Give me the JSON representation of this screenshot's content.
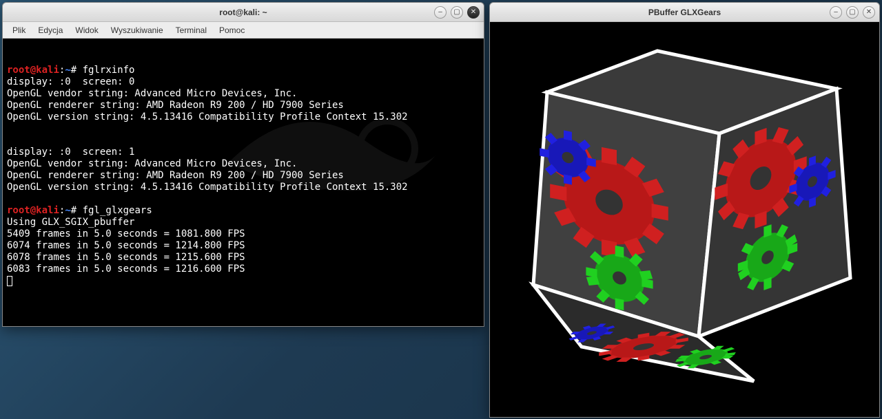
{
  "terminal_window": {
    "title": "root@kali: ~",
    "menu": {
      "file": "Plik",
      "edit": "Edycja",
      "view": "Widok",
      "search": "Wyszukiwanie",
      "terminal": "Terminal",
      "help": "Pomoc"
    },
    "prompt": {
      "user": "root",
      "at": "@",
      "host": "kali",
      "colon": ":",
      "path": "~",
      "symbol": "#"
    },
    "session": {
      "cmd1": "fglrxinfo",
      "out1a": "display: :0  screen: 0",
      "out1b": "OpenGL vendor string: Advanced Micro Devices, Inc.",
      "out1c": "OpenGL renderer string: AMD Radeon R9 200 / HD 7900 Series",
      "out1d": "OpenGL version string: 4.5.13416 Compatibility Profile Context 15.302",
      "blank": "",
      "out2a": "display: :0  screen: 1",
      "out2b": "OpenGL vendor string: Advanced Micro Devices, Inc.",
      "out2c": "OpenGL renderer string: AMD Radeon R9 200 / HD 7900 Series",
      "out2d": "OpenGL version string: 4.5.13416 Compatibility Profile Context 15.302",
      "cmd2": "fgl_glxgears",
      "out3a": "Using GLX_SGIX_pbuffer",
      "out3b": "5409 frames in 5.0 seconds = 1081.800 FPS",
      "out3c": "6074 frames in 5.0 seconds = 1214.800 FPS",
      "out3d": "6078 frames in 5.0 seconds = 1215.600 FPS",
      "out3e": "6083 frames in 5.0 seconds = 1216.600 FPS"
    }
  },
  "glx_window": {
    "title": "PBuffer GLXGears"
  },
  "icons": {
    "minimize": "–",
    "maximize": "▢",
    "close": "✕"
  }
}
